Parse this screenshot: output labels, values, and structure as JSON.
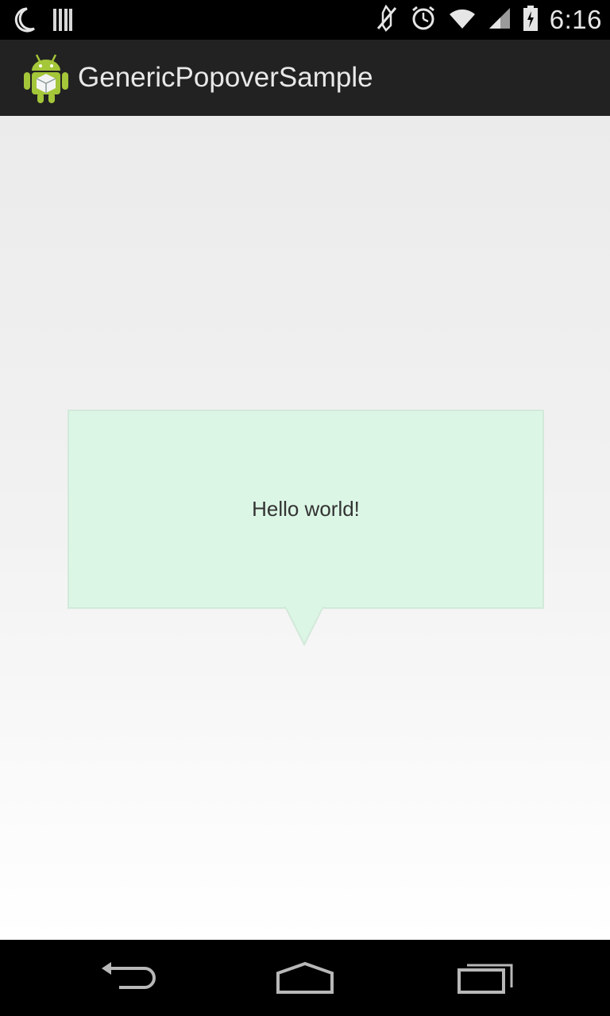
{
  "status_bar": {
    "time": "6:16",
    "icons": [
      "moon-icon",
      "barcode-icon",
      "muted-icon",
      "alarm-icon",
      "wifi-icon",
      "signal-icon",
      "battery-icon"
    ]
  },
  "action_bar": {
    "app_icon": "android-icon",
    "title": "GenericPopoverSample"
  },
  "popover": {
    "text": "Hello world!",
    "background_color": "#dcf6e5"
  },
  "nav_bar": {
    "icons": [
      "back-icon",
      "home-icon",
      "recents-icon"
    ]
  }
}
